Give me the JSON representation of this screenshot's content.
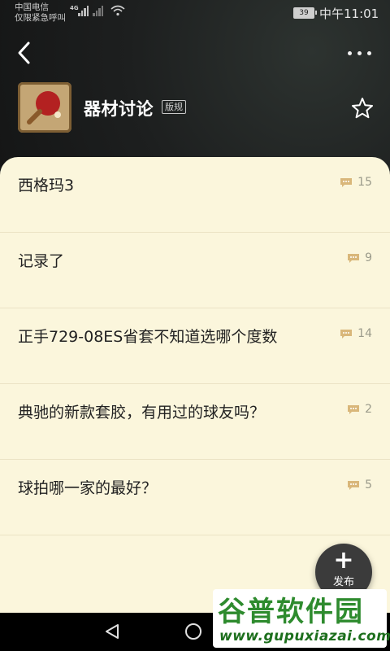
{
  "status_bar": {
    "carrier_line1": "中国电信",
    "carrier_line2": "仅限紧急呼叫",
    "network": "4G",
    "battery": "39",
    "time": "中午11:01"
  },
  "header": {
    "back_icon": "chevron-left-icon",
    "more_icon": "more-dots-icon",
    "forum_icon": "ping-pong-paddle-icon",
    "forum_title": "器材讨论",
    "rules_label": "版规",
    "favorite_icon": "star-outline-icon"
  },
  "posts": [
    {
      "title": "西格玛3",
      "comments": "15"
    },
    {
      "title": "记录了",
      "comments": "9"
    },
    {
      "title": "正手729-08ES省套不知道选哪个度数",
      "comments": "14"
    },
    {
      "title": "典驰的新款套胶，有用过的球友吗？",
      "comments": "2"
    },
    {
      "title": "球拍哪一家的最好？",
      "comments": "5"
    }
  ],
  "fab": {
    "icon": "plus-icon",
    "label": "发布"
  },
  "watermark": {
    "title": "谷普软件园",
    "url": "www.gupuxiazai.com"
  },
  "colors": {
    "panel_bg": "#fbf6dc",
    "comment_icon": "#d9b77a",
    "header_bg": "#1d1f1f",
    "watermark_green": "#2e8b2e"
  }
}
